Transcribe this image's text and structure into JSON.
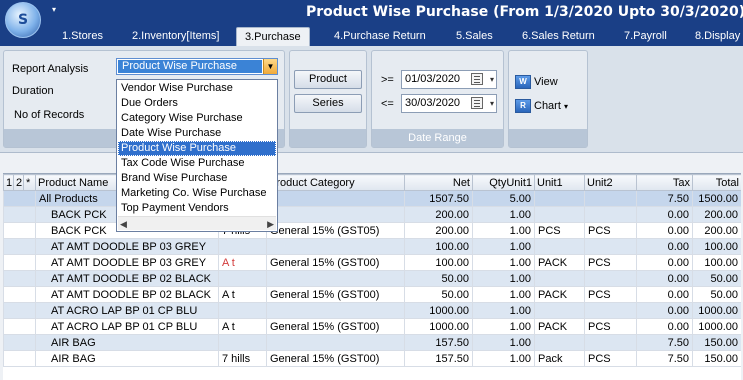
{
  "app": {
    "logo_letter": "S",
    "title": "Product Wise Purchase (From 1/3/2020 Upto 30/3/2020)",
    "colors": {
      "titlebar": "#1a3f86",
      "selection": "#2f6fcc",
      "accent_orange": "#f0a93a"
    }
  },
  "tabs": [
    {
      "label": "1.Stores"
    },
    {
      "label": "2.Inventory[Items]"
    },
    {
      "label": "3.Purchase"
    },
    {
      "label": "4.Purchase Return"
    },
    {
      "label": "5.Sales"
    },
    {
      "label": "6.Sales Return"
    },
    {
      "label": "7.Payroll"
    },
    {
      "label": "8.Display"
    }
  ],
  "active_tab": "3.Purchase",
  "ribbon": {
    "report_label": "Report Analysis",
    "duration_label": "Duration",
    "records_label": "No of Records",
    "report_value": "Product Wise Purchase",
    "dropdown_options": [
      "Vendor Wise Purchase",
      "Due Orders",
      "Category Wise Purchase",
      "Date Wise Purchase",
      "Product Wise Purchase",
      "Tax Code Wise Purchase",
      "Brand Wise Purchase",
      "Marketing Co. Wise Purchase",
      "Top Payment Vendors"
    ],
    "selected_option": "Product Wise Purchase",
    "product_button": "Product",
    "series_button": "Series",
    "gte_label": ">=",
    "lte_label": "<=",
    "date_from": "01/03/2020",
    "date_to": "30/03/2020",
    "date_range_label": "Date Range",
    "view_label": "View",
    "chart_label": "Chart"
  },
  "grid": {
    "outline_levels": [
      "1",
      "2",
      "*"
    ],
    "columns": [
      "Product Name",
      "",
      "Product Category",
      "Net",
      "QtyUnit1",
      "Unit1",
      "Unit2",
      "Tax",
      "Total"
    ],
    "rows": [
      {
        "type": "sum",
        "name": "All Products",
        "extra": "",
        "category": "",
        "net": "1507.50",
        "qty": "5.00",
        "unit1": "",
        "unit2": "",
        "tax": "7.50",
        "total": "1500.00"
      },
      {
        "type": "grp",
        "name": "BACK PCK",
        "extra": "",
        "category": "",
        "net": "200.00",
        "qty": "1.00",
        "unit1": "",
        "unit2": "",
        "tax": "0.00",
        "total": "200.00"
      },
      {
        "type": "row",
        "name": "BACK PCK",
        "extra": "7 hills",
        "category": "General 15% (GST05)",
        "net": "200.00",
        "qty": "1.00",
        "unit1": "PCS",
        "unit2": "PCS",
        "tax": "0.00",
        "total": "200.00"
      },
      {
        "type": "grp",
        "name": "AT AMT DOODLE BP 03 GREY",
        "extra": "",
        "category": "",
        "net": "100.00",
        "qty": "1.00",
        "unit1": "",
        "unit2": "",
        "tax": "0.00",
        "total": "100.00"
      },
      {
        "type": "row",
        "name": "AT AMT DOODLE BP 03 GREY",
        "extra": "A t",
        "extra_red": true,
        "category": "General 15% (GST00)",
        "net": "100.00",
        "qty": "1.00",
        "unit1": "PACK",
        "unit2": "PCS",
        "tax": "0.00",
        "total": "100.00"
      },
      {
        "type": "grp",
        "name": "AT AMT DOODLE BP 02 BLACK",
        "extra": "",
        "category": "",
        "net": "50.00",
        "qty": "1.00",
        "unit1": "",
        "unit2": "",
        "tax": "0.00",
        "total": "50.00"
      },
      {
        "type": "row",
        "name": "AT AMT DOODLE BP 02 BLACK",
        "extra": "A t",
        "category": "General 15% (GST00)",
        "net": "50.00",
        "qty": "1.00",
        "unit1": "PACK",
        "unit2": "PCS",
        "tax": "0.00",
        "total": "50.00"
      },
      {
        "type": "grp",
        "name": "AT ACRO LAP BP 01 CP BLU",
        "extra": "",
        "category": "",
        "net": "1000.00",
        "qty": "1.00",
        "unit1": "",
        "unit2": "",
        "tax": "0.00",
        "total": "1000.00"
      },
      {
        "type": "row",
        "name": "AT ACRO LAP BP 01 CP BLU",
        "extra": "A t",
        "category": "General 15% (GST00)",
        "net": "1000.00",
        "qty": "1.00",
        "unit1": "PACK",
        "unit2": "PCS",
        "tax": "0.00",
        "total": "1000.00"
      },
      {
        "type": "grp",
        "name": "AIR BAG",
        "extra": "",
        "category": "",
        "net": "157.50",
        "qty": "1.00",
        "unit1": "",
        "unit2": "",
        "tax": "7.50",
        "total": "150.00"
      },
      {
        "type": "row",
        "name": "AIR BAG",
        "extra": "7 hills",
        "category": "General 15% (GST00)",
        "net": "157.50",
        "qty": "1.00",
        "unit1": "Pack",
        "unit2": "PCS",
        "tax": "7.50",
        "total": "150.00"
      }
    ]
  }
}
